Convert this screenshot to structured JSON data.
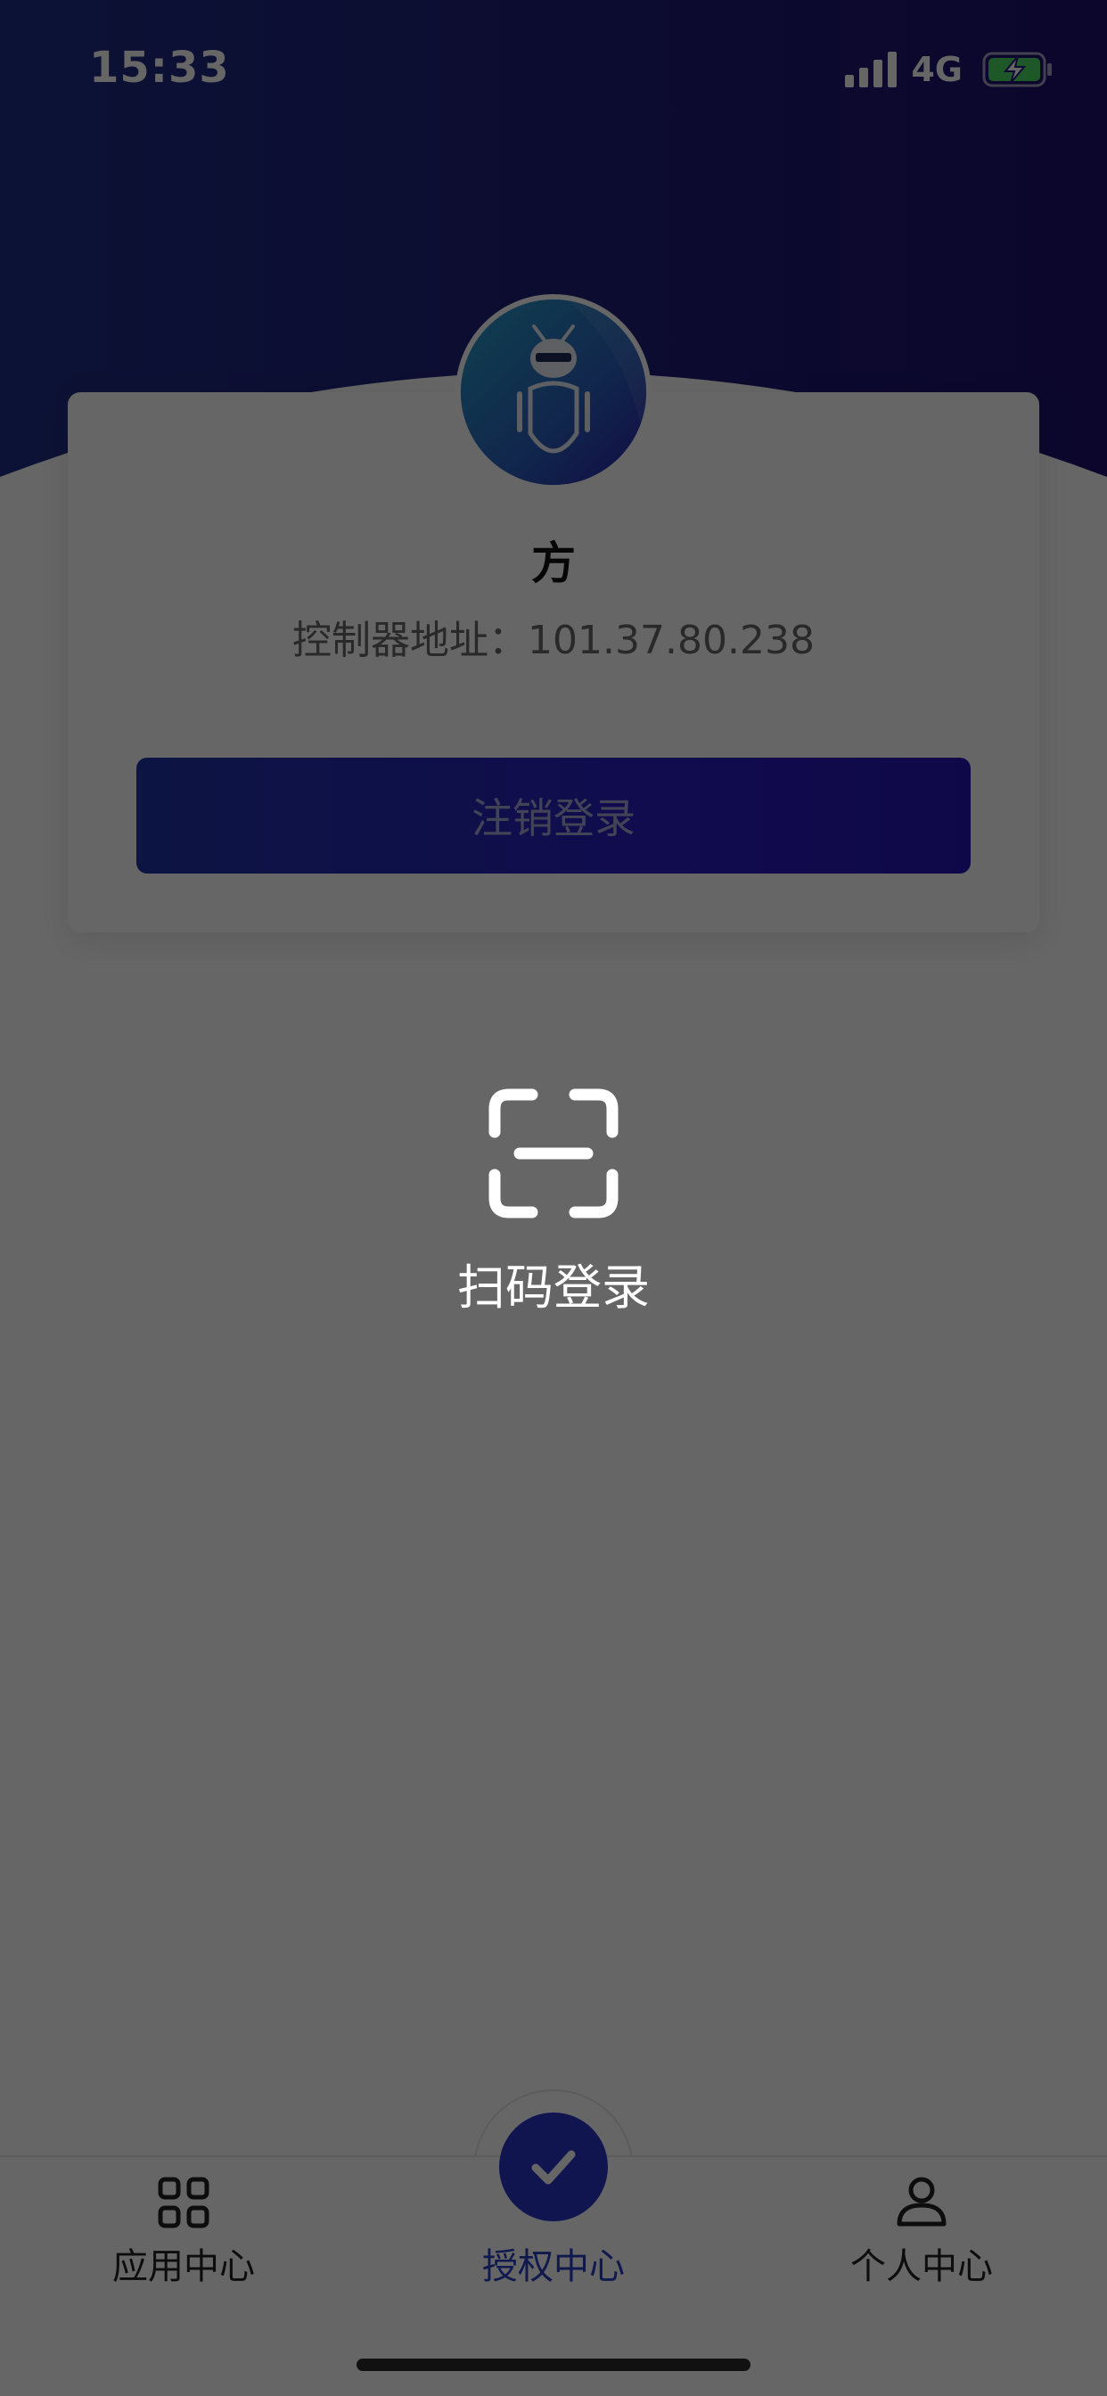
{
  "status_bar": {
    "time": "15:33",
    "network": "4G",
    "battery_color": "#4cd964"
  },
  "profile": {
    "name": "方",
    "controller_label": "控制器地址：",
    "controller_address": "101.37.80.238",
    "logout_label": "注销登录"
  },
  "scan": {
    "label": "扫码登录",
    "icon": "scan-icon"
  },
  "tab_bar": {
    "items": [
      {
        "label": "应用中心",
        "icon": "grid-icon",
        "active": false
      },
      {
        "label": "授权中心",
        "icon": "check-icon",
        "active": true
      },
      {
        "label": "个人中心",
        "icon": "person-icon",
        "active": false
      }
    ]
  },
  "colors": {
    "header_gradient_start": "#1f2f86",
    "header_gradient_end": "#1e0f6e",
    "accent": "#2836c8"
  }
}
